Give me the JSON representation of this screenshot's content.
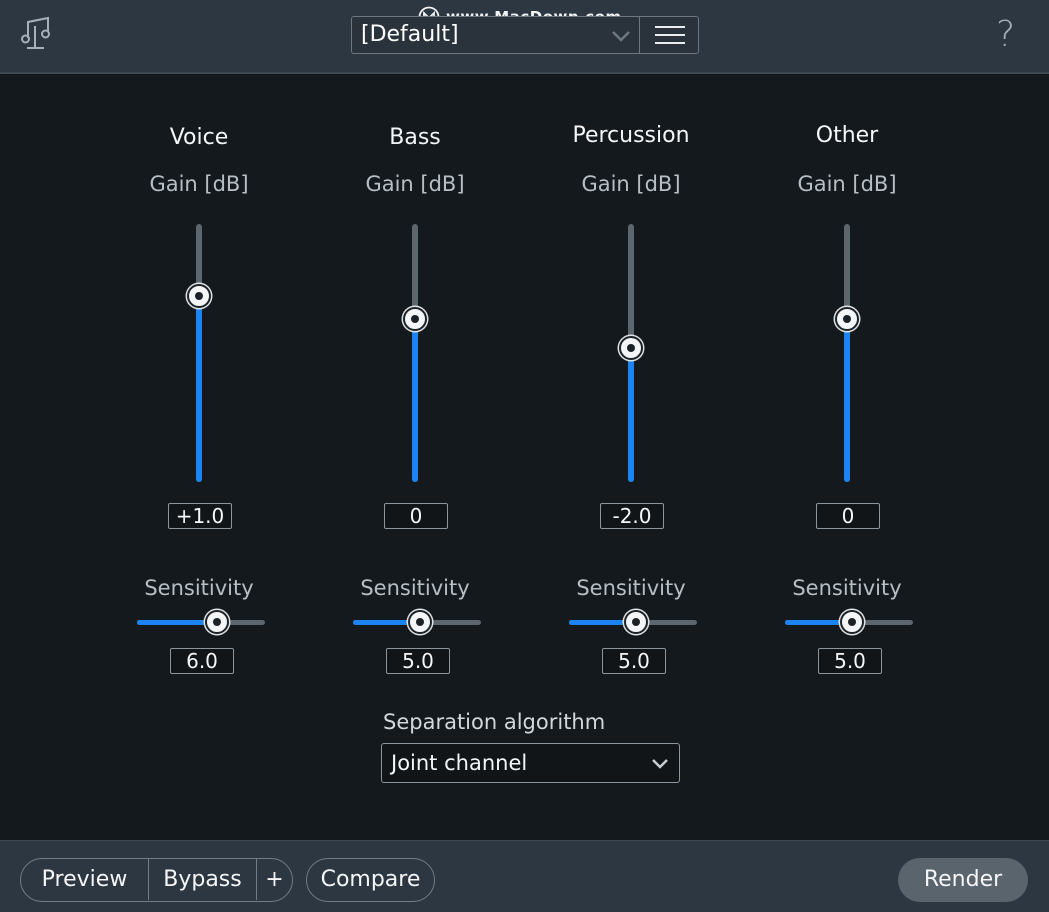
{
  "header": {
    "app_icon": "music-note-icon",
    "watermark": "www.MacDown.com",
    "preset_value": "[Default]",
    "menu_icon": "hamburger-menu-icon",
    "help_label": "?"
  },
  "channels": [
    {
      "title": "Voice",
      "gain_label": "Gain [dB]",
      "gain_value": "+1.0",
      "gain_level": 0.72,
      "sens_label": "Sensitivity",
      "sens_value": "6.0",
      "sens_level": 0.6
    },
    {
      "title": "Bass",
      "gain_label": "Gain [dB]",
      "gain_value": "0",
      "gain_level": 0.63,
      "sens_label": "Sensitivity",
      "sens_value": "5.0",
      "sens_level": 0.5
    },
    {
      "title": "Percussion",
      "gain_label": "Gain [dB]",
      "gain_value": "-2.0",
      "gain_level": 0.52,
      "sens_label": "Sensitivity",
      "sens_value": "5.0",
      "sens_level": 0.5
    },
    {
      "title": "Other",
      "gain_label": "Gain [dB]",
      "gain_value": "0",
      "gain_level": 0.63,
      "sens_label": "Sensitivity",
      "sens_value": "5.0",
      "sens_level": 0.5
    }
  ],
  "algorithm": {
    "label": "Separation algorithm",
    "value": "Joint channel"
  },
  "footer": {
    "preview": "Preview",
    "bypass": "Bypass",
    "plus": "+",
    "compare": "Compare",
    "render": "Render"
  },
  "colors": {
    "accent": "#1b84f2",
    "background": "#14191d",
    "header": "#2d3741"
  }
}
